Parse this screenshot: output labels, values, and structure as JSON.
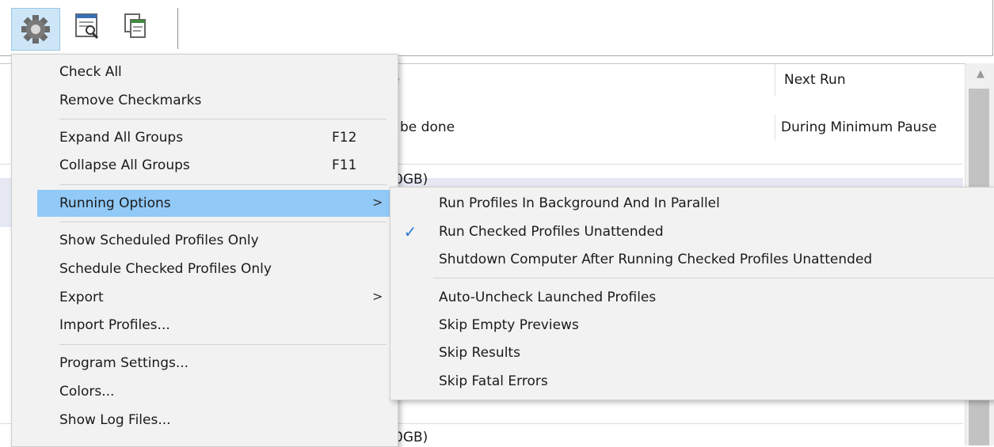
{
  "list": {
    "header_partial": "e",
    "next_run_header": "Next Run",
    "selected_row_text": "be done",
    "selected_row_next": "During Minimum Pause",
    "row_size_1": "0GB)",
    "row_size_2": "0GB)"
  },
  "main_menu": {
    "check_all": "Check All",
    "remove_checkmarks": "Remove Checkmarks",
    "expand_all": "Expand All Groups",
    "expand_all_shortcut": "F12",
    "collapse_all": "Collapse All Groups",
    "collapse_all_shortcut": "F11",
    "running_options": "Running Options",
    "show_scheduled": "Show Scheduled Profiles Only",
    "schedule_checked": "Schedule Checked Profiles Only",
    "export": "Export",
    "import_profiles": "Import Profiles...",
    "program_settings": "Program Settings...",
    "colors": "Colors...",
    "show_log_files": "Show Log Files...",
    "arrow": ">"
  },
  "submenu": {
    "run_background": "Run Profiles In Background And In Parallel",
    "run_checked_unattended": "Run Checked Profiles Unattended",
    "run_checked_unattended_checked": true,
    "shutdown_after": "Shutdown Computer After Running Checked Profiles Unattended",
    "auto_uncheck": "Auto-Uncheck Launched Profiles",
    "skip_empty_previews": "Skip Empty Previews",
    "skip_results": "Skip Results",
    "skip_fatal_errors": "Skip Fatal Errors"
  },
  "colors": {
    "highlight": "#91c9f7",
    "checkmark": "#2b79d4",
    "menu_bg": "#f2f2f2"
  },
  "icons": [
    "gear-icon",
    "document-magnifier-icon",
    "copy-documents-icon",
    "checkmark-icon",
    "chevron-right-icon"
  ]
}
